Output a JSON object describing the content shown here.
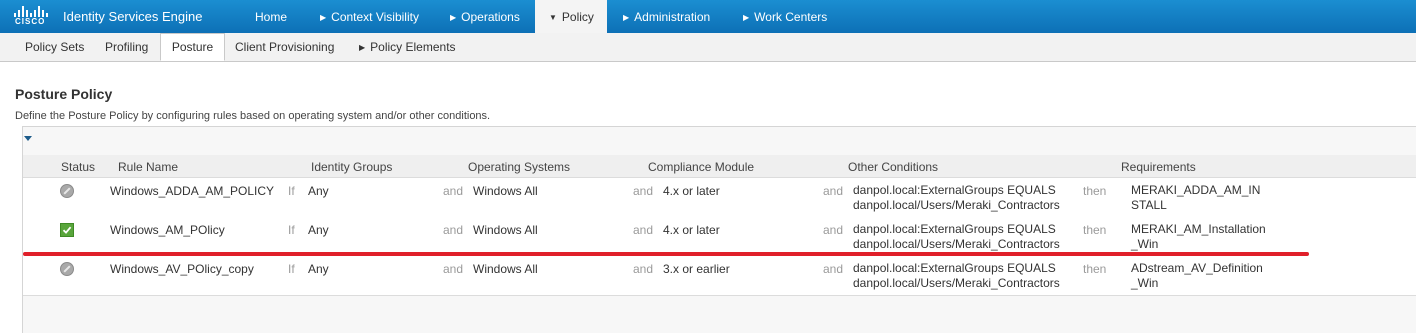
{
  "brand": {
    "logo_text": "CISCO",
    "title": "Identity Services Engine"
  },
  "top_nav": [
    {
      "label": "Home",
      "has_caret": false
    },
    {
      "label": "Context Visibility",
      "caret": "▶"
    },
    {
      "label": "Operations",
      "caret": "▶"
    },
    {
      "label": "Policy",
      "caret": "▼"
    },
    {
      "label": "Administration",
      "caret": "▶"
    },
    {
      "label": "Work Centers",
      "caret": "▶"
    }
  ],
  "sub_nav": [
    {
      "label": "Policy Sets"
    },
    {
      "label": "Profiling"
    },
    {
      "label": "Posture"
    },
    {
      "label": "Client Provisioning"
    },
    {
      "label": "Policy Elements",
      "caret": "▶"
    }
  ],
  "page": {
    "title": "Posture Policy",
    "description": "Define the Posture Policy by configuring rules based on operating system and/or other conditions."
  },
  "table": {
    "headers": {
      "status": "Status",
      "rule_name": "Rule Name",
      "identity_groups": "Identity Groups",
      "operating_systems": "Operating Systems",
      "compliance_module": "Compliance Module",
      "other_conditions": "Other Conditions",
      "requirements": "Requirements"
    },
    "keywords": {
      "if": "If",
      "and": "and",
      "then": "then"
    },
    "rows": [
      {
        "status": "disabled",
        "rule_name": "Windows_ADDA_AM_POLICY",
        "identity_groups": "Any",
        "operating_systems": "Windows All",
        "compliance_module": "4.x or later",
        "other_conditions_line1": "danpol.local:ExternalGroups EQUALS",
        "other_conditions_line2": "danpol.local/Users/Meraki_Contractors",
        "requirements": "MERAKI_ADDA_AM_INSTALL"
      },
      {
        "status": "enabled",
        "rule_name": "Windows_AM_POlicy",
        "identity_groups": "Any",
        "operating_systems": "Windows All",
        "compliance_module": "4.x or later",
        "other_conditions_line1": "danpol.local:ExternalGroups EQUALS",
        "other_conditions_line2": "danpol.local/Users/Meraki_Contractors",
        "requirements": "MERAKI_AM_Installation_Win"
      },
      {
        "status": "disabled",
        "rule_name": "Windows_AV_POlicy_copy",
        "identity_groups": "Any",
        "operating_systems": "Windows All",
        "compliance_module": "3.x or earlier",
        "other_conditions_line1": "danpol.local:ExternalGroups EQUALS",
        "other_conditions_line2": "danpol.local/Users/Meraki_Contractors",
        "requirements": "ADstream_AV_Definition_Win"
      }
    ]
  },
  "colors": {
    "topbar": "#0d70b6",
    "enabled_status": "#59a53b",
    "disabled_status": "#a9a9a9",
    "annotation_line": "#e0202a"
  }
}
